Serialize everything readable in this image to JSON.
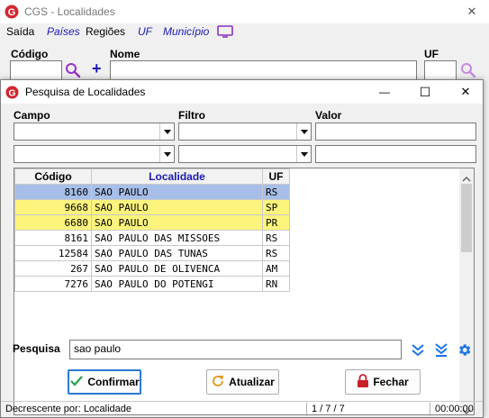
{
  "main_window": {
    "title": "CGS - Localidades",
    "close_glyph": "✕",
    "menu": [
      "Saída",
      "Países",
      "Regiões",
      "UF",
      "Município"
    ],
    "fields": {
      "codigo_label": "Código",
      "nome_label": "Nome",
      "uf_label": "UF",
      "add_glyph": "+"
    }
  },
  "dialog": {
    "title": "Pesquisa de Localidades",
    "controls": {
      "minimize": "—",
      "maximize": "☐",
      "close": "✕"
    },
    "filter_headers": {
      "campo": "Campo",
      "filtro": "Filtro",
      "valor": "Valor"
    },
    "table": {
      "columns": [
        "Código",
        "Localidade",
        "UF"
      ],
      "rows": [
        {
          "code": "8160",
          "name": "SAO PAULO",
          "uf": "RS"
        },
        {
          "code": "9668",
          "name": "SAO PAULO",
          "uf": "SP"
        },
        {
          "code": "6680",
          "name": "SAO PAULO",
          "uf": "PR"
        },
        {
          "code": "8161",
          "name": "SAO PAULO DAS MISSOES",
          "uf": "RS"
        },
        {
          "code": "12584",
          "name": "SAO PAULO DAS TUNAS",
          "uf": "RS"
        },
        {
          "code": "267",
          "name": "SAO PAULO DE OLIVENCA",
          "uf": "AM"
        },
        {
          "code": "7276",
          "name": "SAO PAULO DO POTENGI",
          "uf": "RN"
        }
      ]
    },
    "search": {
      "label": "Pesquisa",
      "value": "sao paulo"
    },
    "buttons": {
      "confirm": "Confirmar",
      "refresh": "Atualizar",
      "close": "Fechar"
    },
    "status": {
      "sort": "Decrescente por: Localidade",
      "records": "1 / 7 / 7",
      "time": "00:00:00"
    }
  },
  "colors": {
    "selected_row": "#a6bee8",
    "highlight_row": "#fcf47c",
    "menu_blue": "#1a1ab4",
    "logo_red": "#d2262e",
    "search_icon": "#9b2fc5",
    "chevron_blue": "#1a73e8"
  }
}
